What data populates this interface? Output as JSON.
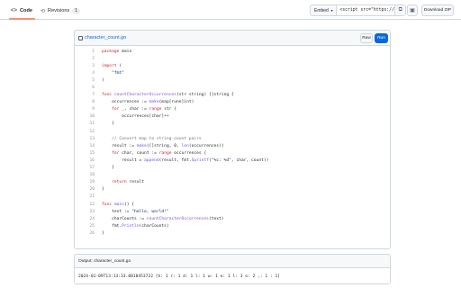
{
  "tabs": {
    "code": {
      "label": "Code",
      "icon": "code-icon"
    },
    "revisions": {
      "label": "Revisions",
      "count": "1",
      "icon": "history-icon"
    }
  },
  "toolbar": {
    "embed_label": "Embed",
    "embed_value": "<script src=\"https://",
    "download_label": "Download ZIP"
  },
  "file": {
    "name": "character_count.go",
    "raw_label": "Raw",
    "run_label": "Run"
  },
  "code_lines": [
    {
      "n": "1",
      "parts": [
        [
          "kw",
          "package"
        ],
        [
          "tx",
          " main"
        ]
      ]
    },
    {
      "n": "2",
      "parts": []
    },
    {
      "n": "3",
      "parts": [
        [
          "kw",
          "import"
        ],
        [
          "tx",
          " ("
        ]
      ]
    },
    {
      "n": "4",
      "parts": [
        [
          "str",
          "    \"fmt\""
        ]
      ]
    },
    {
      "n": "5",
      "parts": [
        [
          "tx",
          ")"
        ]
      ]
    },
    {
      "n": "6",
      "parts": []
    },
    {
      "n": "7",
      "parts": [
        [
          "kw",
          "func"
        ],
        [
          "tx",
          " "
        ],
        [
          "fn",
          "countCharacterOccurrences"
        ],
        [
          "tx",
          "(str string) []string {"
        ]
      ]
    },
    {
      "n": "8",
      "parts": [
        [
          "tx",
          "    occurrences := "
        ],
        [
          "fn",
          "make"
        ],
        [
          "tx",
          "(map[rune]int)"
        ]
      ]
    },
    {
      "n": "9",
      "parts": [
        [
          "tx",
          "    "
        ],
        [
          "kw",
          "for"
        ],
        [
          "tx",
          " _, char := "
        ],
        [
          "kw",
          "range"
        ],
        [
          "tx",
          " str {"
        ]
      ]
    },
    {
      "n": "10",
      "parts": [
        [
          "tx",
          "        occurrences[char]++"
        ]
      ]
    },
    {
      "n": "11",
      "parts": [
        [
          "tx",
          "    }"
        ]
      ]
    },
    {
      "n": "12",
      "parts": []
    },
    {
      "n": "13",
      "parts": [
        [
          "cm",
          "    // Convert map to string-count pairs"
        ]
      ]
    },
    {
      "n": "14",
      "parts": [
        [
          "tx",
          "    result := "
        ],
        [
          "fn",
          "make"
        ],
        [
          "tx",
          "([]string, 0, "
        ],
        [
          "fn",
          "len"
        ],
        [
          "tx",
          "(occurrences))"
        ]
      ]
    },
    {
      "n": "15",
      "parts": [
        [
          "tx",
          "    "
        ],
        [
          "kw",
          "for"
        ],
        [
          "tx",
          " char, count := "
        ],
        [
          "kw",
          "range"
        ],
        [
          "tx",
          " occurrences {"
        ]
      ]
    },
    {
      "n": "16",
      "parts": [
        [
          "tx",
          "        result = "
        ],
        [
          "fn",
          "append"
        ],
        [
          "tx",
          "(result, fmt."
        ],
        [
          "fn",
          "Sprintf"
        ],
        [
          "tx",
          "("
        ],
        [
          "str",
          "\"%c: %d\""
        ],
        [
          "tx",
          ", char, count))"
        ]
      ]
    },
    {
      "n": "17",
      "parts": [
        [
          "tx",
          "    }"
        ]
      ]
    },
    {
      "n": "18",
      "parts": []
    },
    {
      "n": "19",
      "parts": [
        [
          "tx",
          "    "
        ],
        [
          "kw",
          "return"
        ],
        [
          "tx",
          " result"
        ]
      ]
    },
    {
      "n": "20",
      "parts": [
        [
          "tx",
          "}"
        ]
      ]
    },
    {
      "n": "21",
      "parts": []
    },
    {
      "n": "22",
      "parts": [
        [
          "kw",
          "func"
        ],
        [
          "tx",
          " "
        ],
        [
          "fn",
          "main"
        ],
        [
          "tx",
          "() {"
        ]
      ]
    },
    {
      "n": "23",
      "parts": [
        [
          "tx",
          "    text := "
        ],
        [
          "str",
          "\"hello, world!\""
        ]
      ]
    },
    {
      "n": "24",
      "parts": [
        [
          "tx",
          "    charCounts := "
        ],
        [
          "fn",
          "countCharacterOccurrences"
        ],
        [
          "tx",
          "(text)"
        ]
      ]
    },
    {
      "n": "25",
      "parts": [
        [
          "tx",
          "    fmt."
        ],
        [
          "fn",
          "Println"
        ],
        [
          "tx",
          "(charCounts)"
        ]
      ]
    },
    {
      "n": "26",
      "parts": [
        [
          "tx",
          "}"
        ]
      ]
    }
  ],
  "output": {
    "title": "Output: character_count.go",
    "text": "2024-01-09T13:13:33.0818453722 [h: 1 r: 1 d: 1 l: 1 w: 1 e: 1 l: 3 o: 2 ,: 1 : 1]"
  }
}
